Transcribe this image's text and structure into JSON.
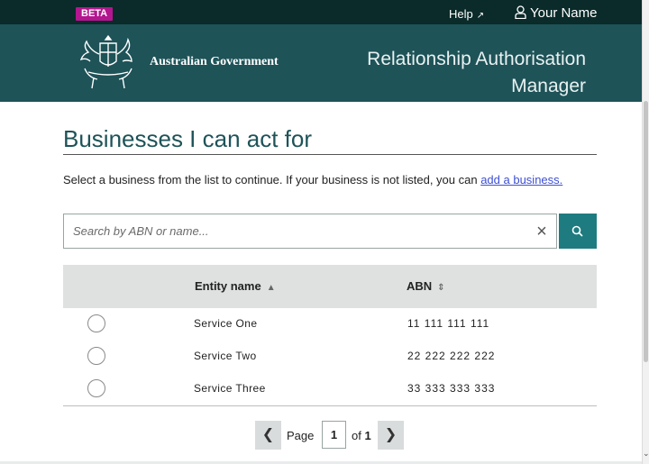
{
  "topbar": {
    "beta": "BETA",
    "help": "Help",
    "user": "Your Name"
  },
  "header": {
    "gov": "Australian Government",
    "app_title_line1": "Relationship Authorisation",
    "app_title_line2": "Manager"
  },
  "page": {
    "title": "Businesses I can act for",
    "intro": "Select a business from the list to continue. If your business is not listed, you can",
    "add_link": "add a business."
  },
  "search": {
    "placeholder": "Search by ABN or name..."
  },
  "table": {
    "columns": [
      "Entity name",
      "ABN"
    ],
    "rows": [
      {
        "name": "Service One",
        "abn": "11 111 111 111"
      },
      {
        "name": "Service Two",
        "abn": "22 222 222 222"
      },
      {
        "name": "Service Three",
        "abn": "33 333 333 333"
      }
    ]
  },
  "pagination": {
    "page_label": "Page",
    "current": "1",
    "of_label": "of",
    "total": "1"
  },
  "colors": {
    "header_bg": "#1e5358",
    "accent": "#1e7b80",
    "beta": "#b3168f"
  }
}
